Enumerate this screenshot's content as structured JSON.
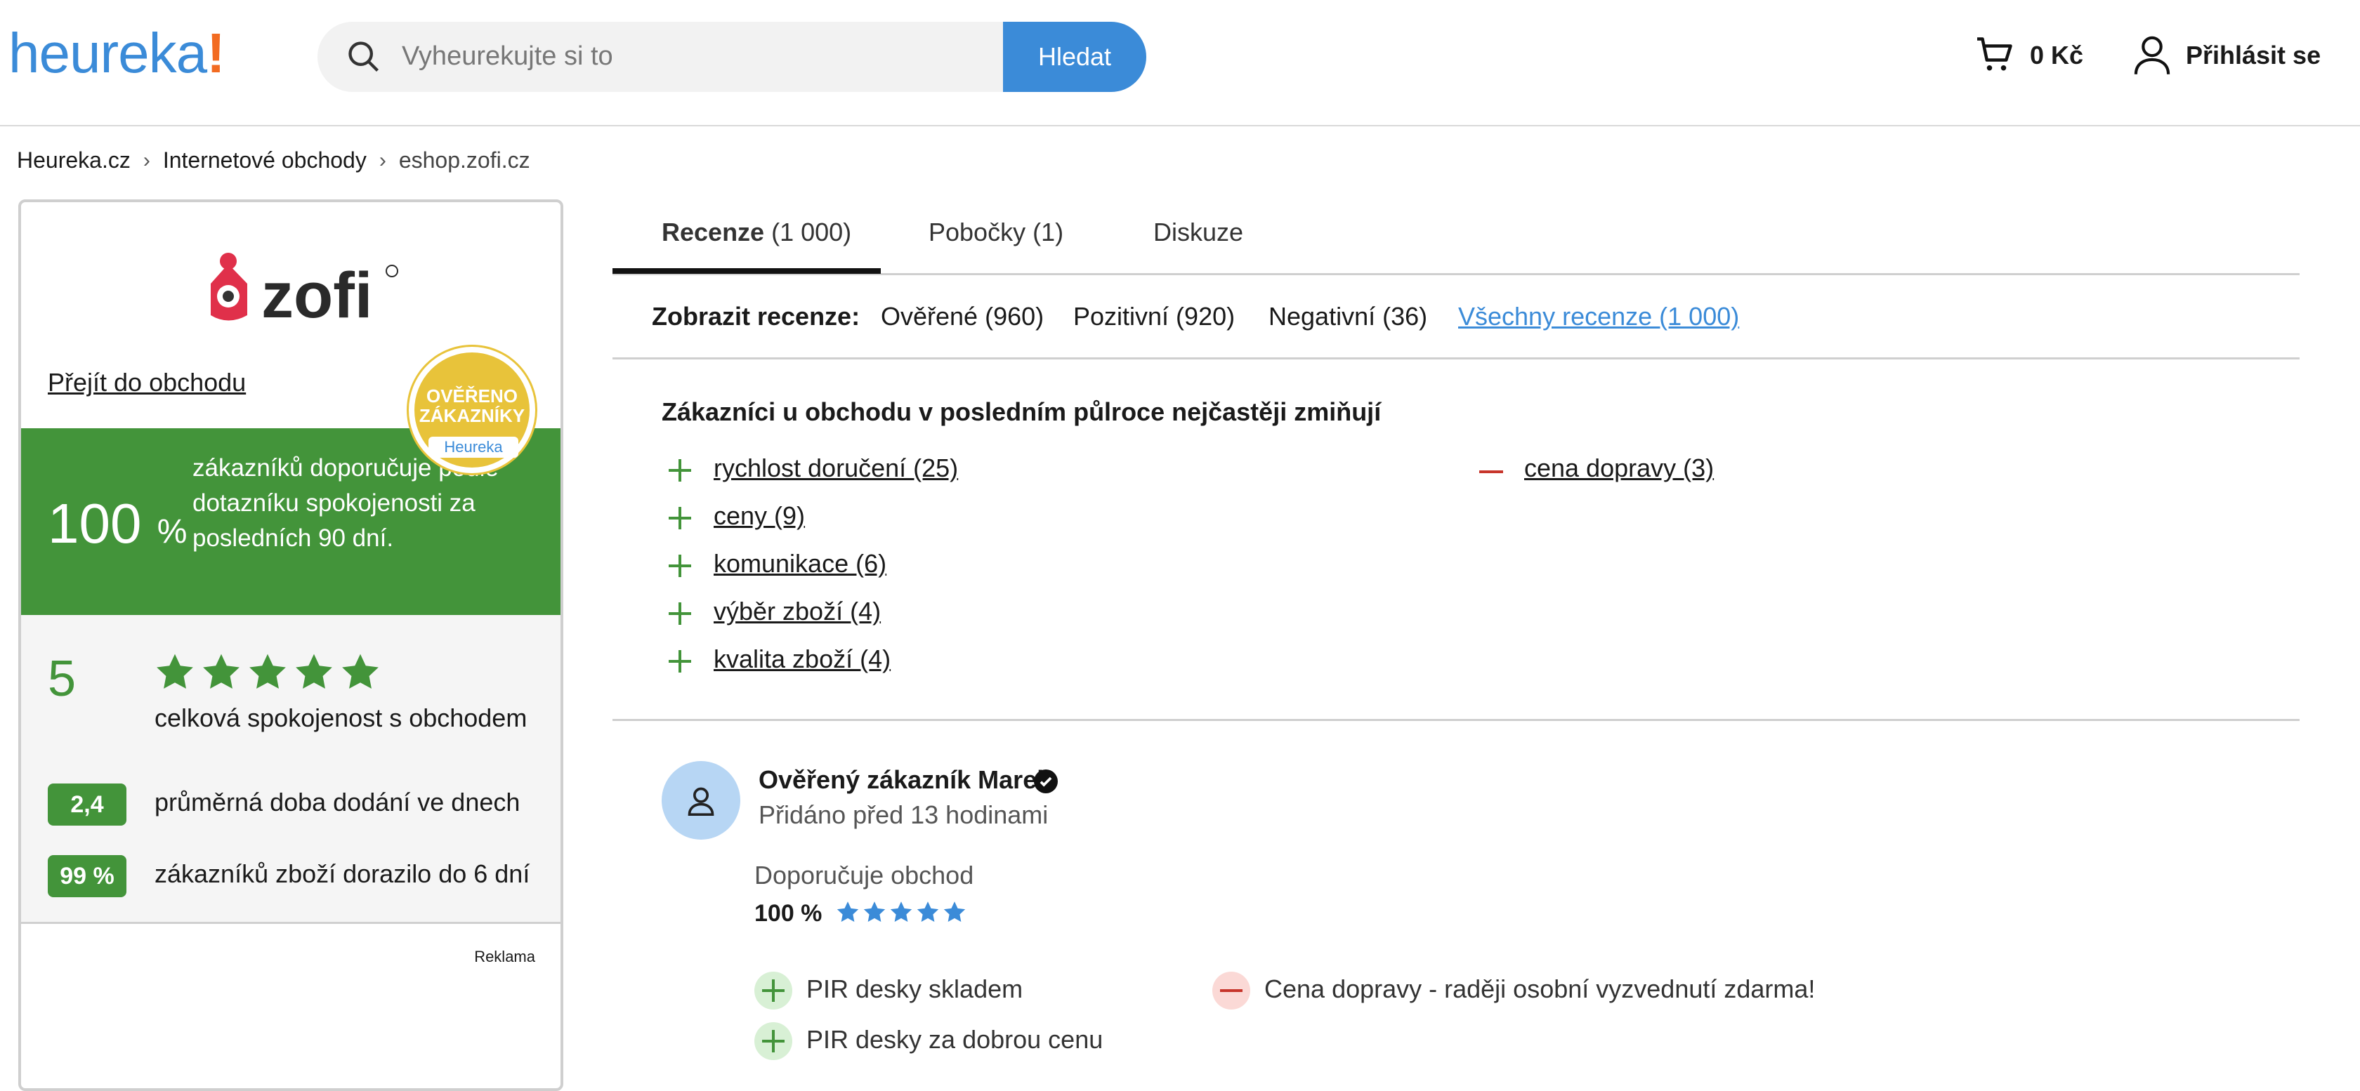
{
  "header": {
    "logo_text": "heureka",
    "logo_exclaim": "!",
    "search_placeholder": "Vyheurekujte si to",
    "search_button": "Hledat",
    "cart_value": "0 Kč",
    "login_label": "Přihlásit se"
  },
  "breadcrumb": [
    "Heureka.cz",
    "Internetové obchody",
    "eshop.zofi.cz"
  ],
  "shop": {
    "goto_label": "Přejít do obchodu",
    "badge_line1": "OVĚŘENO",
    "badge_line2": "ZÁKAZNÍKY",
    "badge_brand": "Heureka",
    "recommend_pct": "100",
    "recommend_unit": "%",
    "recommend_text": "zákazníků doporučuje podle dotazníku spokojenosti za posledních 90 dní.",
    "rating": "5",
    "rating_stars": 5,
    "rating_label": "celková spokojenost s obchodem",
    "delivery_days": "2,4",
    "delivery_label": "průměrná doba dodání ve dnech",
    "arrived_pct": "99 %",
    "arrived_label": "zákazníků zboží dorazilo do 6 dní",
    "ad_label": "Reklama"
  },
  "tabs": [
    {
      "label": "Recenze",
      "count": "(1 000)"
    },
    {
      "label": "Pobočky (1)"
    },
    {
      "label": "Diskuze"
    }
  ],
  "filters": {
    "label": "Zobrazit recenze:",
    "items": [
      "Ověřené (960)",
      "Pozitivní (920)",
      "Negativní (36)",
      "Všechny recenze (1 000)"
    ]
  },
  "mentions": {
    "title": "Zákazníci u obchodu v posledním půlroce nejčastěji zmiňují",
    "positive": [
      "rychlost doručení (25)",
      "ceny (9)",
      "komunikace (6)",
      "výběr zboží (4)",
      "kvalita zboží (4)"
    ],
    "negative": [
      "cena dopravy (3)"
    ]
  },
  "review": {
    "author": "Ověřený zákazník Marek",
    "added": "Přidáno před 13 hodinami",
    "recommend_label": "Doporučuje obchod",
    "percent": "100 %",
    "stars": 5,
    "pros": [
      "PIR desky skladem",
      "PIR desky za dobrou cenu"
    ],
    "cons": [
      "Cena dopravy - raději osobní vyzvednutí zdarma!"
    ]
  },
  "colors": {
    "brand_blue": "#3b8bd8",
    "brand_orange": "#f26b21",
    "green": "#43943a",
    "red": "#c7352b"
  }
}
